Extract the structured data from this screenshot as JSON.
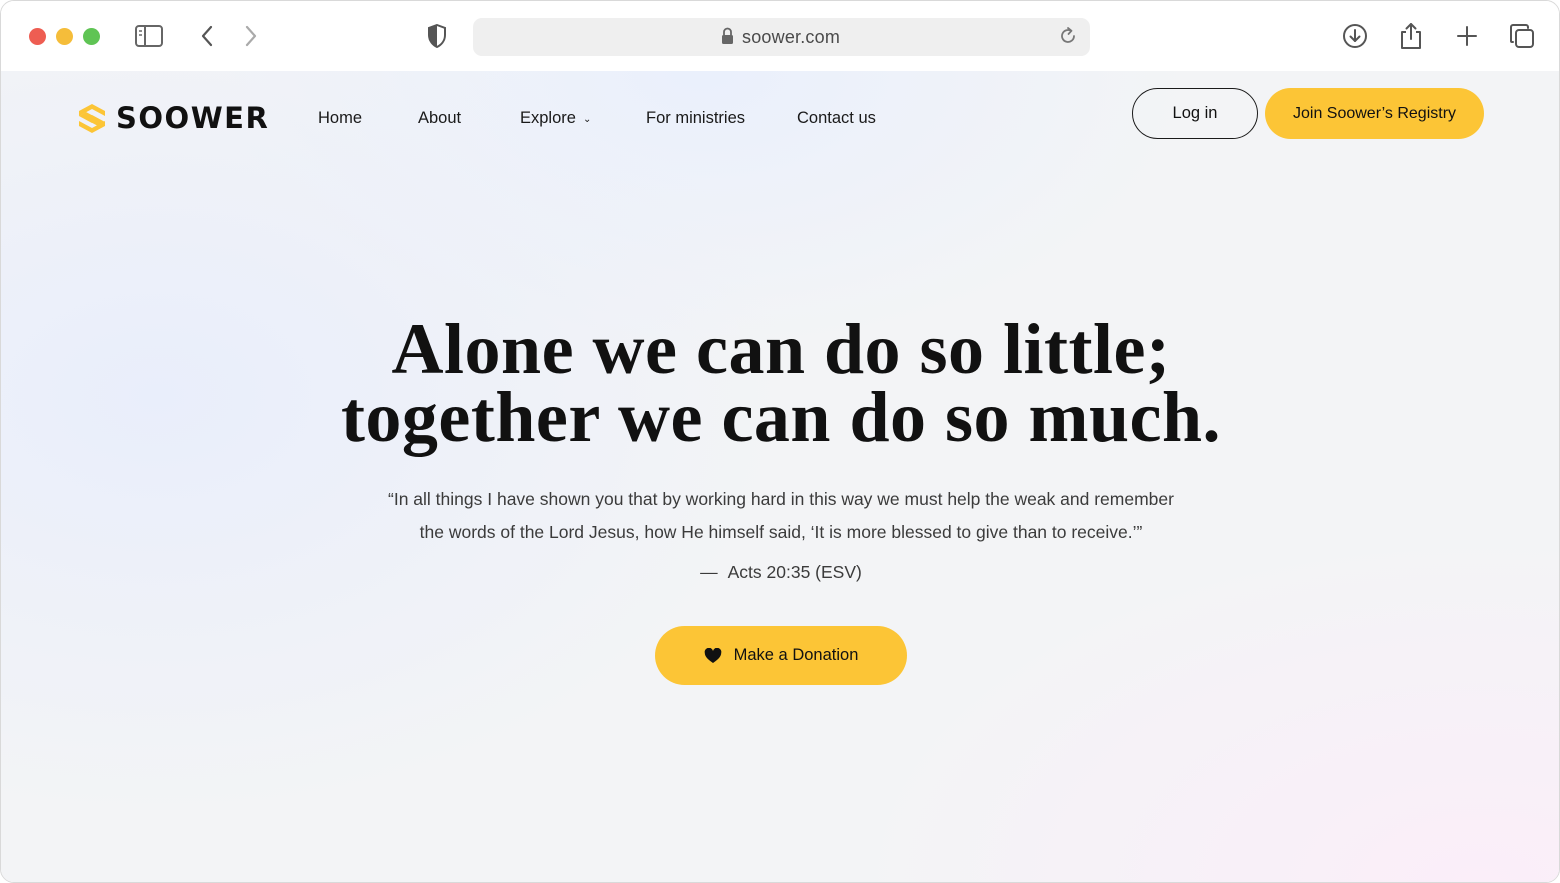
{
  "browser": {
    "url": "soower.com"
  },
  "site": {
    "logo_text": "SOOWER",
    "brand_color": "#fcc536"
  },
  "nav": {
    "items": [
      {
        "label": "Home"
      },
      {
        "label": "About"
      },
      {
        "label": "Explore",
        "has_dropdown": true
      },
      {
        "label": "For ministries"
      },
      {
        "label": "Contact us"
      }
    ]
  },
  "header_actions": {
    "login_label": "Log in",
    "join_label": "Join Soower’s Registry"
  },
  "hero": {
    "title_line1": "Alone we can do so little;",
    "title_line2": "together we can do so much.",
    "quote_line1": "“In all things I have shown you that by working hard in this way we must help the weak and remember",
    "quote_line2": "the words of the Lord Jesus, how He himself said, ‘It is more blessed to give than to receive.’”",
    "citation_dash": "—",
    "citation": "Acts 20:35 (ESV)",
    "donate_label": "Make a Donation"
  }
}
